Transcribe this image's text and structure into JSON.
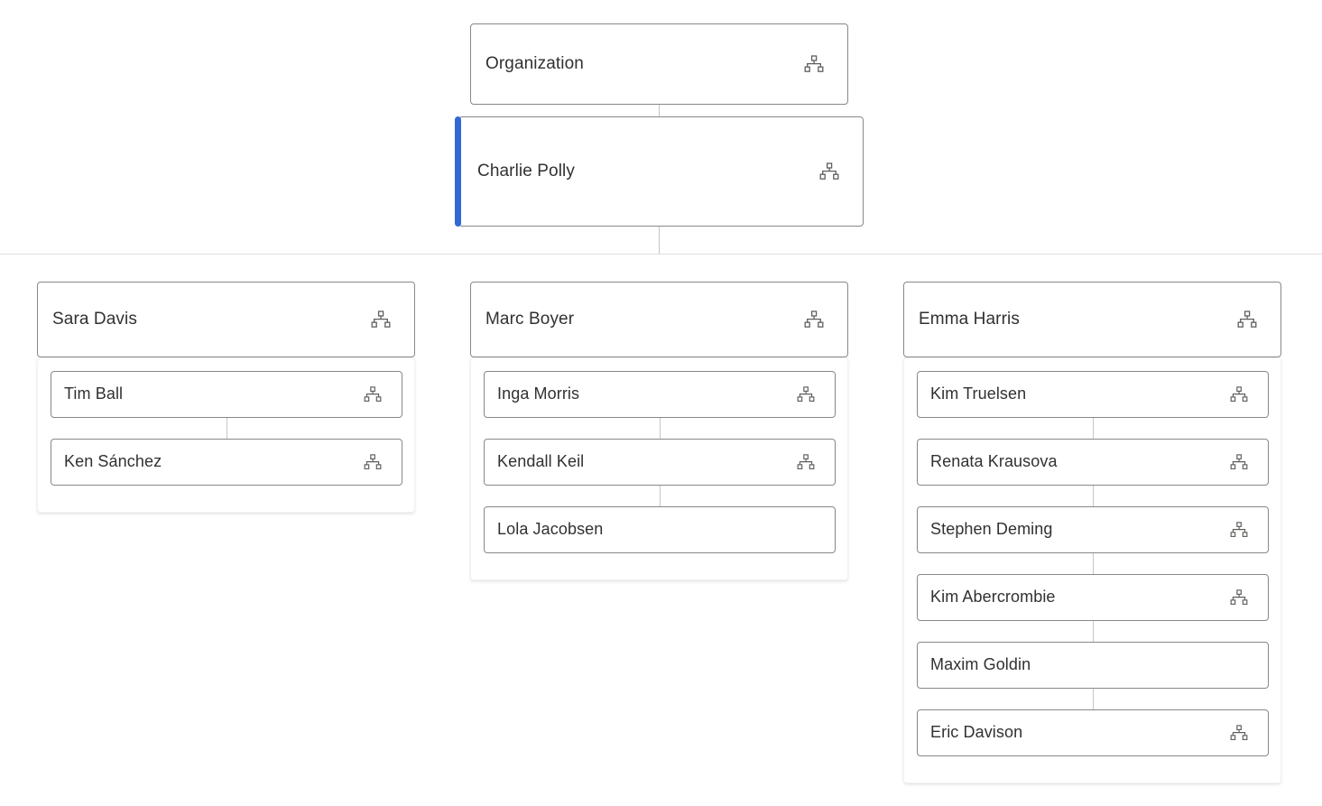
{
  "chart_data": {
    "type": "tree",
    "title": "Organization",
    "icon_name": "hierarchy-icon",
    "selected_node": "Charlie Polly",
    "accent_color": "#3069d3",
    "card_border_color": "#8a8886",
    "connector_color": "#c8c6c4",
    "divider_color": "#e1dfdd",
    "text_color": "#323130",
    "nodes": [
      {
        "label": "Organization",
        "level": 0,
        "has_icon": true,
        "selected": false
      },
      {
        "label": "Charlie Polly",
        "level": 1,
        "has_icon": true,
        "selected": true
      }
    ],
    "branches": [
      {
        "manager": {
          "label": "Sara Davis",
          "has_icon": true
        },
        "reports": [
          {
            "label": "Tim Ball",
            "has_icon": true
          },
          {
            "label": "Ken Sánchez",
            "has_icon": true
          }
        ]
      },
      {
        "manager": {
          "label": "Marc Boyer",
          "has_icon": true
        },
        "reports": [
          {
            "label": "Inga Morris",
            "has_icon": true
          },
          {
            "label": "Kendall Keil",
            "has_icon": true
          },
          {
            "label": "Lola Jacobsen",
            "has_icon": false
          }
        ]
      },
      {
        "manager": {
          "label": "Emma Harris",
          "has_icon": true
        },
        "reports": [
          {
            "label": "Kim Truelsen",
            "has_icon": true
          },
          {
            "label": "Renata Krausova",
            "has_icon": true
          },
          {
            "label": "Stephen Deming",
            "has_icon": true
          },
          {
            "label": "Kim Abercrombie",
            "has_icon": true
          },
          {
            "label": "Maxim Goldin",
            "has_icon": false
          },
          {
            "label": "Eric Davison",
            "has_icon": true
          }
        ]
      }
    ]
  },
  "root": {
    "label": "Organization"
  },
  "selected": {
    "label": "Charlie Polly"
  },
  "branch0": {
    "manager": "Sara Davis",
    "r0": "Tim Ball",
    "r1": "Ken Sánchez"
  },
  "branch1": {
    "manager": "Marc Boyer",
    "r0": "Inga Morris",
    "r1": "Kendall Keil",
    "r2": "Lola Jacobsen"
  },
  "branch2": {
    "manager": "Emma Harris",
    "r0": "Kim Truelsen",
    "r1": "Renata Krausova",
    "r2": "Stephen Deming",
    "r3": "Kim Abercrombie",
    "r4": "Maxim Goldin",
    "r5": "Eric Davison"
  }
}
